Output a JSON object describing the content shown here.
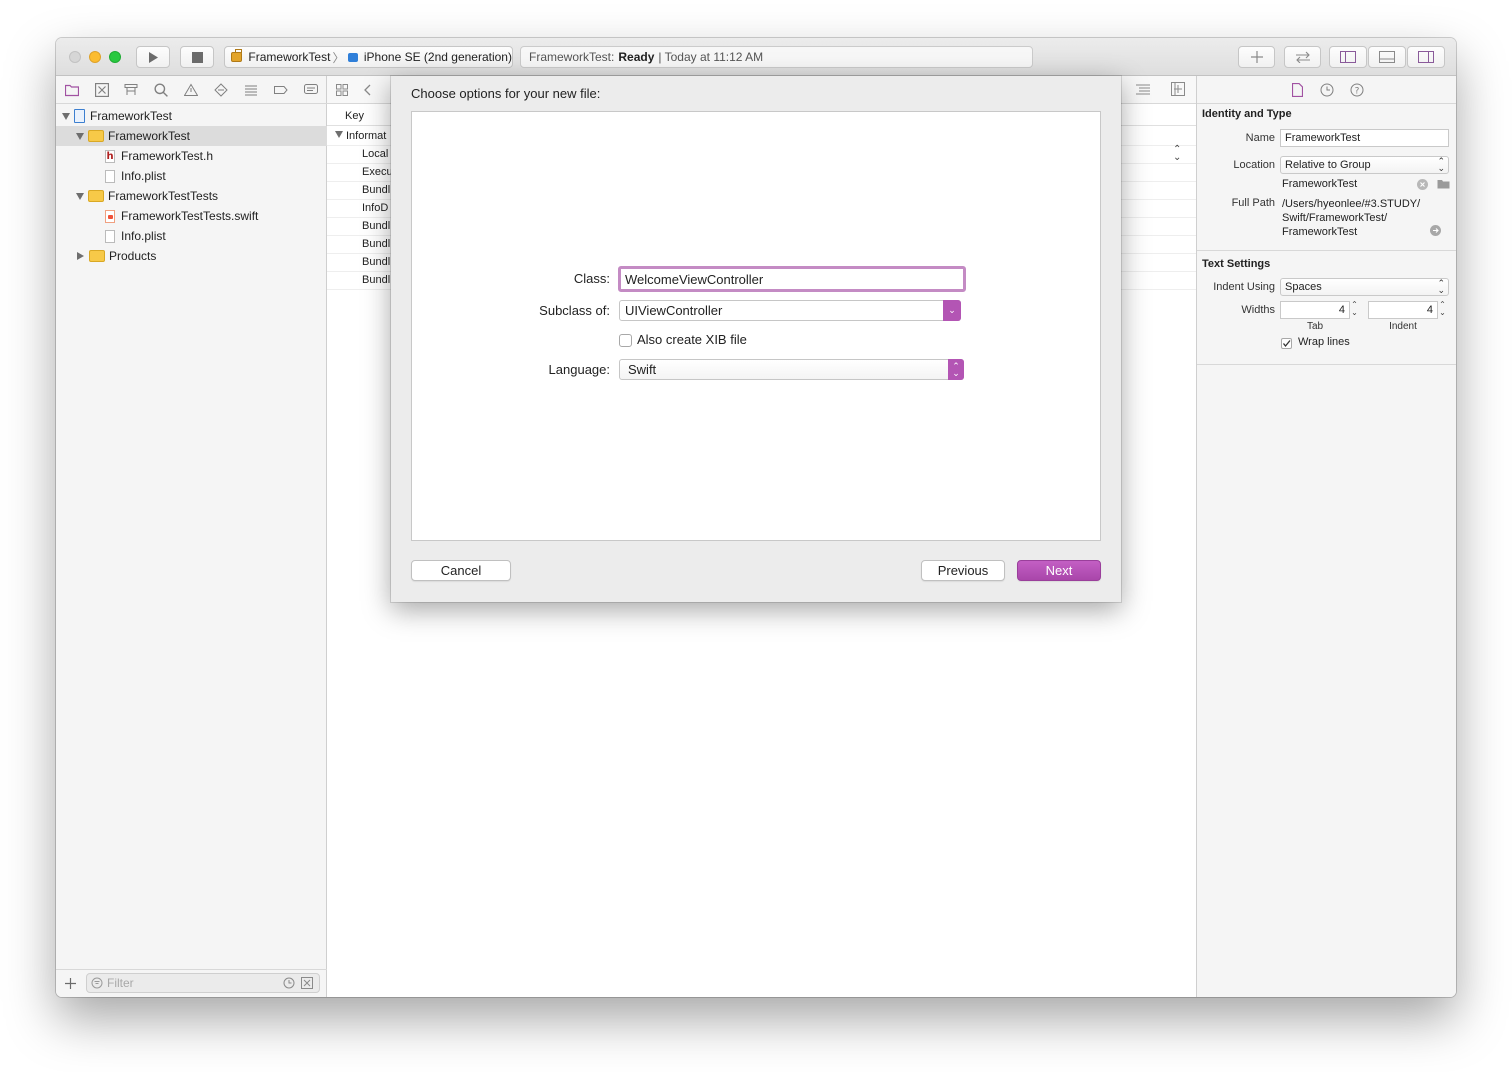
{
  "toolbar": {
    "scheme_target": "FrameworkTest",
    "scheme_separator": "〉",
    "scheme_device": "iPhone SE (2nd generation)",
    "activity_prefix": "FrameworkTest:",
    "activity_status": "Ready",
    "activity_time": "| Today at 11:12 AM"
  },
  "navigator": {
    "tree": [
      {
        "label": "FrameworkTest",
        "kind": "project"
      },
      {
        "label": "FrameworkTest",
        "kind": "folder"
      },
      {
        "label": "FrameworkTest.h",
        "kind": "header-file"
      },
      {
        "label": "Info.plist",
        "kind": "plist-file"
      },
      {
        "label": "FrameworkTestTests",
        "kind": "folder"
      },
      {
        "label": "FrameworkTestTests.swift",
        "kind": "swift-file"
      },
      {
        "label": "Info.plist",
        "kind": "plist-file"
      },
      {
        "label": "Products",
        "kind": "folder"
      }
    ],
    "filter_placeholder": "Filter"
  },
  "editor": {
    "key_header": "Key",
    "rows": [
      "Informat",
      "Local",
      "Execu",
      "Bundl",
      "InfoD",
      "Bundl",
      "Bundl",
      "Bundl",
      "Bundl"
    ]
  },
  "dialog": {
    "title": "Choose options for your new file:",
    "class_label": "Class:",
    "class_value": "WelcomeViewController",
    "subclass_label": "Subclass of:",
    "subclass_value": "UIViewController",
    "xib_label": "Also create XIB file",
    "xib_checked": false,
    "language_label": "Language:",
    "language_value": "Swift",
    "cancel": "Cancel",
    "previous": "Previous",
    "next": "Next"
  },
  "inspector": {
    "identity_title": "Identity and Type",
    "name_label": "Name",
    "name_value": "FrameworkTest",
    "location_label": "Location",
    "location_value": "Relative to Group",
    "location_file": "FrameworkTest",
    "fullpath_label": "Full Path",
    "fullpath_1": "/Users/hyeonlee/#3.STUDY/",
    "fullpath_2": "Swift/FrameworkTest/",
    "fullpath_3": "FrameworkTest",
    "text_settings_title": "Text Settings",
    "indent_using_label": "Indent Using",
    "indent_using_value": "Spaces",
    "widths_label": "Widths",
    "tab_value": "4",
    "indent_value": "4",
    "tab_caption": "Tab",
    "indent_caption": "Indent",
    "wrap_label": "Wrap lines",
    "wrap_checked": true
  },
  "colors": {
    "accent": "#b355b4",
    "folder": "#f7c948",
    "selection": "#dcdcdc"
  }
}
